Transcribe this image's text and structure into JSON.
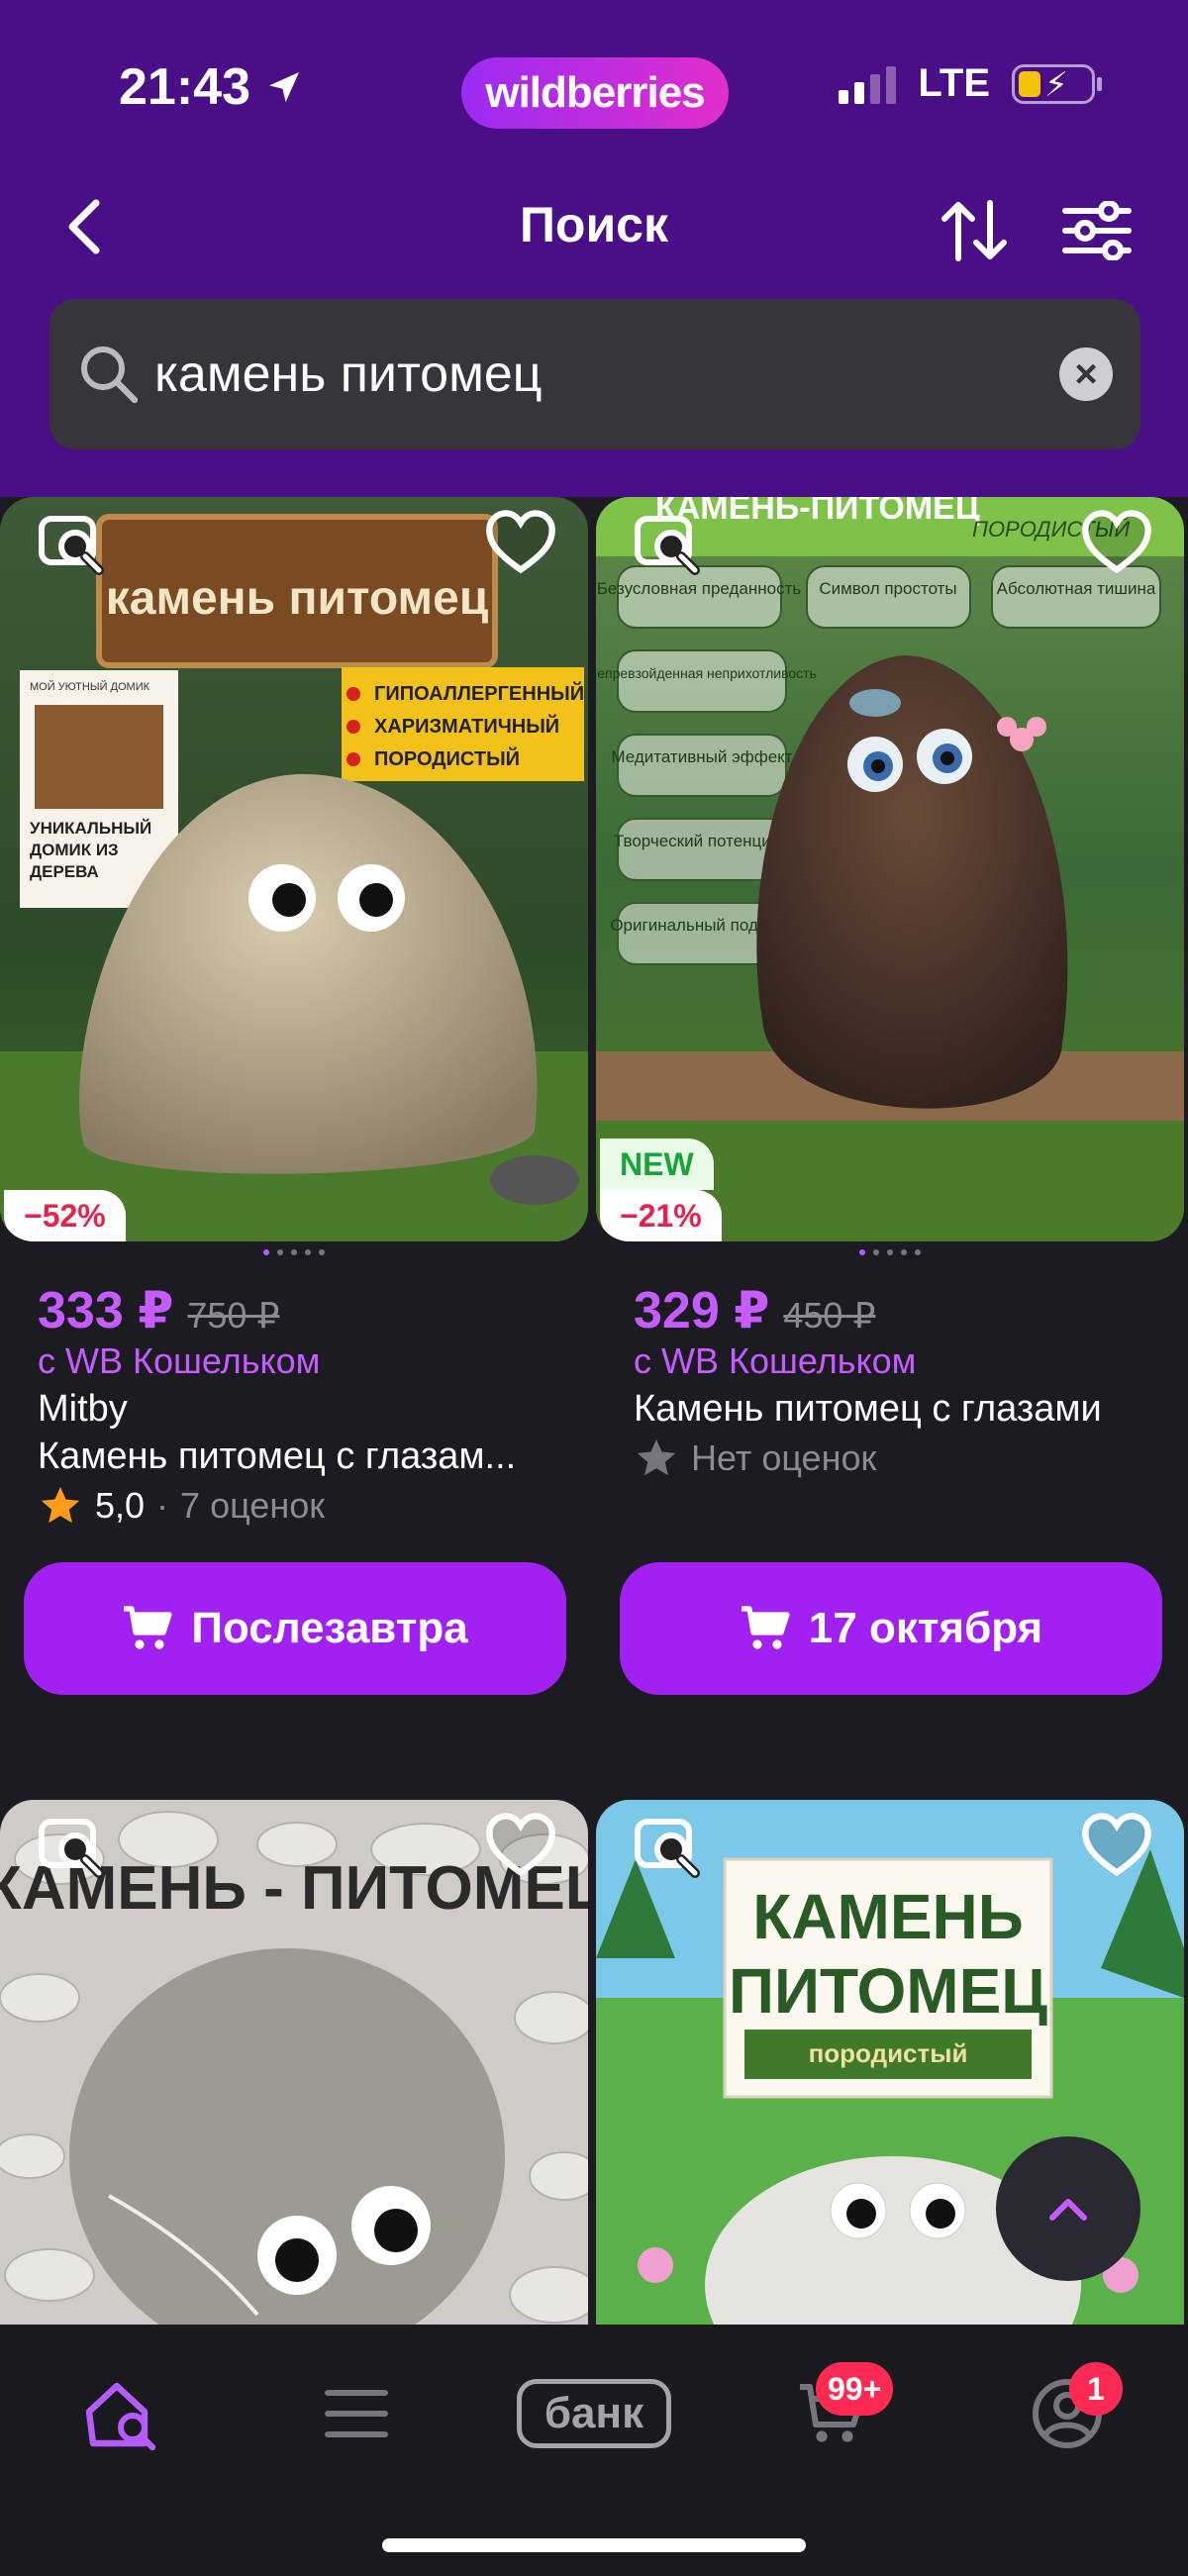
{
  "status_bar": {
    "time": "21:43",
    "network": "LTE",
    "brand": "wildberries"
  },
  "header": {
    "title": "Поиск"
  },
  "search": {
    "query": "камень питомец"
  },
  "products": [
    {
      "price": "333 ₽",
      "old_price": "750 ₽",
      "wallet_note": "с WB Кошельком",
      "brand": "Mitby",
      "name": "Камень питомец с глазам...",
      "rating_value": "5,0",
      "rating_sep": "·",
      "rating_count": "7 оценок",
      "discount": "−52%",
      "delivery": "Послезавтра",
      "image_caption": "камень питомец",
      "image_tags": [
        "ГИПОАЛЛЕРГЕННЫЙ",
        "ХАРИЗМАТИЧНЫЙ",
        "ПОРОДИСТЫЙ"
      ],
      "image_side_note": "УНИКАЛЬНЫЙ ДОМИК ИЗ ДЕРЕВА",
      "image_box_label": "МОЙ УЮТНЫЙ ДОМИК"
    },
    {
      "price": "329 ₽",
      "old_price": "450 ₽",
      "wallet_note": "с WB Кошельком",
      "name": "Камень питомец с глазами",
      "no_rating": "Нет оценок",
      "discount": "−21%",
      "new_badge": "NEW",
      "delivery": "17 октября",
      "image_caption": "КАМЕНЬ-ПИТОМЕЦ",
      "image_sub": "ПОРОДИСТЫЙ",
      "image_tags": [
        "Безусловная преданность",
        "Символ простоты",
        "Абсолютная тишина",
        "Непревзойденная неприхотливость",
        "Медитативный эффект",
        "Творческий потенциал",
        "Оригинальный подарок"
      ]
    },
    {
      "image_caption": "КАМЕНЬ - ПИТОМЕЦ"
    },
    {
      "image_caption": "КАМЕНЬ ПИТОМЕЦ",
      "image_sub": "породистый"
    }
  ],
  "nav": {
    "bank_label": "банк",
    "cart_badge": "99+",
    "profile_badge": "1"
  }
}
